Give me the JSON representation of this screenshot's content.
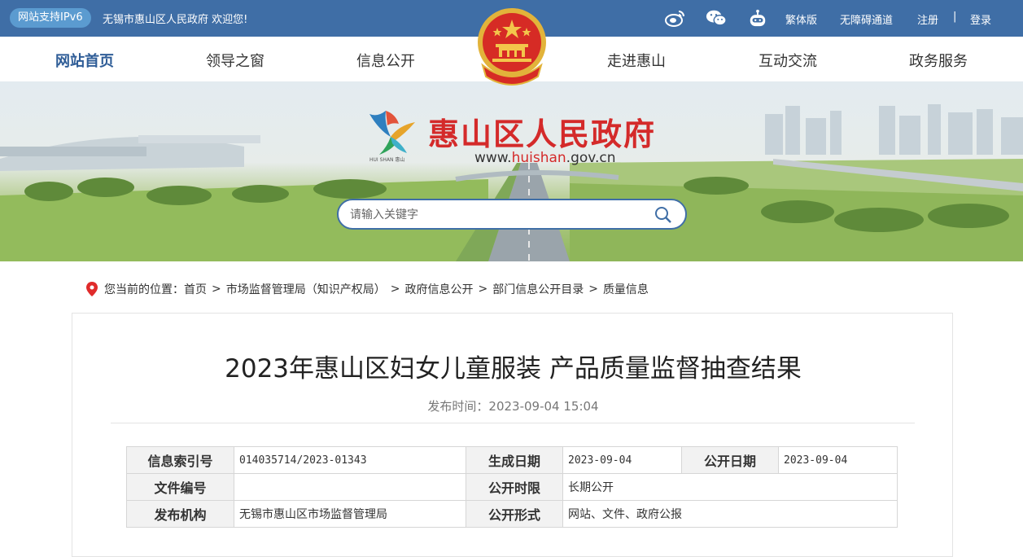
{
  "topbar": {
    "ipv6_badge": "网站支持IPv6",
    "welcome": "无锡市惠山区人民政府 欢迎您!",
    "icons": [
      "weibo-icon",
      "wechat-icon",
      "robot-icon"
    ],
    "links": {
      "traditional": "繁体版",
      "accessible": "无障碍通道",
      "register": "注册",
      "separator": "|",
      "login": "登录"
    }
  },
  "nav": {
    "items": [
      "网站首页",
      "领导之窗",
      "信息公开",
      "走进惠山",
      "互动交流",
      "政务服务"
    ],
    "active_index": 0
  },
  "banner": {
    "logo_text": "HUI SHAN 惠山",
    "site_title": "惠山区人民政府",
    "url_prefix": "www.",
    "url_highlight": "huishan",
    "url_suffix": ".gov.cn"
  },
  "search": {
    "placeholder": "请输入关键字"
  },
  "breadcrumb": {
    "prefix": "您当前的位置：",
    "items": [
      "首页",
      "市场监督管理局（知识产权局）",
      "政府信息公开",
      "部门信息公开目录",
      "质量信息"
    ],
    "separator": ">"
  },
  "article": {
    "title": "2023年惠山区妇女儿童服装 产品质量监督抽查结果",
    "publish_label": "发布时间：",
    "publish_time": "2023-09-04 15:04"
  },
  "info_table": {
    "index_label": "信息索引号",
    "index_value": "014035714/2023-01343",
    "created_label": "生成日期",
    "created_value": "2023-09-04",
    "public_label": "公开日期",
    "public_value": "2023-09-04",
    "doc_no_label": "文件编号",
    "doc_no_value": "",
    "limit_label": "公开时限",
    "limit_value": "长期公开",
    "org_label": "发布机构",
    "org_value": "无锡市惠山区市场监督管理局",
    "form_label": "公开形式",
    "form_value": "网站、文件、政府公报"
  },
  "colors": {
    "primary": "#3f6ea6",
    "accent_red": "#d42a2a",
    "badge": "#5b9bd0"
  }
}
